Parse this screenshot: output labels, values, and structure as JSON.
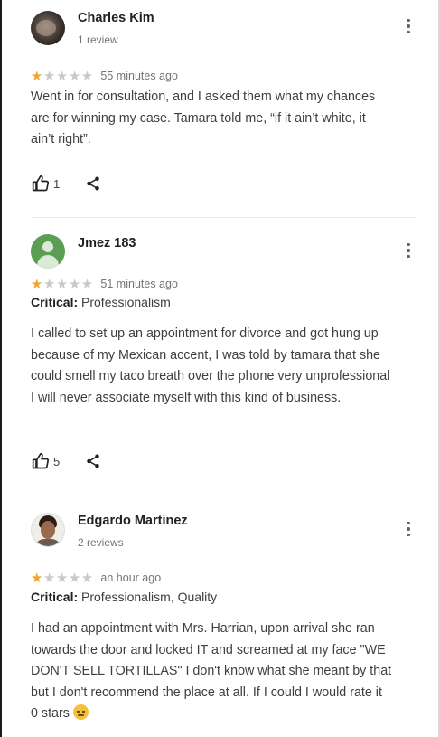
{
  "reviews": [
    {
      "author": "Charles Kim",
      "meta": "1 review",
      "rating": 1,
      "max_rating": 5,
      "time": "55 minutes ago",
      "critical_label": "",
      "critical_value": "",
      "text": "Went in for consultation, and I asked them what my chances are for winning my case. Tamara told me, “if it ain’t white, it ain’t right”.",
      "likes": "1"
    },
    {
      "author": "Jmez 183",
      "meta": "",
      "rating": 1,
      "max_rating": 5,
      "time": "51 minutes ago",
      "critical_label": "Critical:",
      "critical_value": "Professionalism",
      "text": "I called to set up an appointment for divorce and got hung up because of my Mexican accent, I was told by tamara that she could smell my taco breath over the phone very unprofessional I will never associate myself with this kind of business.",
      "likes": "5"
    },
    {
      "author": "Edgardo Martinez",
      "meta": "2 reviews",
      "rating": 1,
      "max_rating": 5,
      "time": "an hour ago",
      "critical_label": "Critical:",
      "critical_value": "Professionalism, Quality",
      "text": "I had an appointment with Mrs. Harrian, upon arrival she ran towards the door and locked IT and screamed at my face \"WE DON'T SELL TORTILLAS\" I don't know what she meant by that but I don't recommend the place at all. If I could I would rate it 0 stars",
      "likes": ""
    }
  ],
  "colors": {
    "star_filled": "#f4a531",
    "star_empty": "#c9c9c9",
    "generic_avatar": "#5b9d52"
  },
  "icons": [
    "more-vert-icon",
    "thumbs-up-icon",
    "share-icon",
    "star-icon",
    "pensive-face-emoji"
  ]
}
